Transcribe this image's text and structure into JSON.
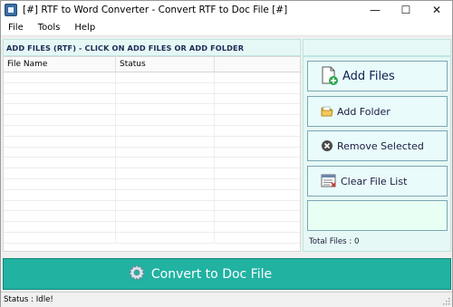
{
  "window": {
    "title": "[#] RTF to Word Converter -  Convert RTF to Doc File [#]",
    "minimize_glyph": "—",
    "maximize_glyph": "☐",
    "close_glyph": "✕"
  },
  "menu": {
    "items": [
      "File",
      "Tools",
      "Help"
    ]
  },
  "files_panel": {
    "header": "ADD FILES (RTF) - CLICK ON ADD FILES OR ADD FOLDER",
    "columns": [
      "File Name",
      "Status",
      ""
    ],
    "rows": []
  },
  "actions": {
    "add_files": "Add Files",
    "add_folder": "Add Folder",
    "remove_selected": "Remove Selected",
    "clear_file_list": "Clear File List",
    "total_files": "Total Files : 0"
  },
  "convert": {
    "label": "Convert to Doc File"
  },
  "status": {
    "text": "Status  :  Idle!"
  },
  "icons": {
    "app": "app-icon",
    "add_files": "add-file-icon",
    "add_folder": "folder-icon",
    "remove": "remove-icon",
    "clear": "clear-list-icon",
    "convert": "gear-icon"
  },
  "colors": {
    "panel_bg": "#e6f8f5",
    "convert_bg": "#21b2a2",
    "header_text": "#1c2a56"
  }
}
